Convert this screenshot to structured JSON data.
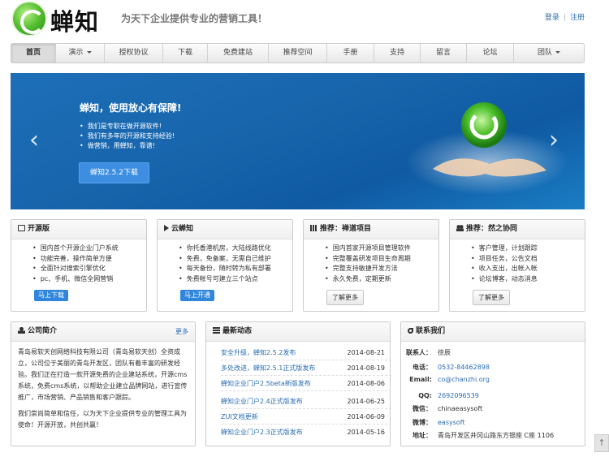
{
  "header": {
    "logo_text": "蝉知",
    "slogan": "为天下企业提供专业的营销工具！",
    "login": "登录",
    "register": "注册"
  },
  "nav": [
    "首页",
    "演示",
    "授权协议",
    "下载",
    "免费建站",
    "推荐空间",
    "手册",
    "支持",
    "留言",
    "论坛",
    "团队"
  ],
  "banner": {
    "title": "蝉知，使用放心有保障!",
    "points": [
      "我们是专职在做开源软件!",
      "我们有多年的开源和支持经验!",
      "做营销，用蝉知，靠谱!"
    ],
    "button": "蝉知2.5.2下载",
    "prev": "‹",
    "next": "›"
  },
  "cards": [
    {
      "title": "开源版",
      "items": [
        "国内首个开源企业门户系统",
        "功能完善，操作简单方便",
        "全面针对搜索引擎优化",
        "pc、手机、微信全网营销"
      ],
      "button": "马上下载"
    },
    {
      "title": "云蝉知",
      "items": [
        "你托香港机房，大陆线路优化",
        "免费，免备案，无需自己维护",
        "每天备份，随时转为私有部署",
        "免费帐号可建立三个站点"
      ],
      "button": "马上开通"
    },
    {
      "title": "推荐：禅道项目",
      "items": [
        "国内首家开源项目管理软件",
        "完整覆盖研发项目生命周期",
        "完整支持敏捷开发方法",
        "永久免费，定期更新"
      ],
      "button": "了解更多"
    },
    {
      "title": "推荐：然之协同",
      "items": [
        "客户管理，计划跟踪",
        "项目任务，公告文档",
        "收入支出，出帐入帐",
        "论坛博客，动态消息"
      ],
      "button": "了解更多"
    }
  ],
  "intro": {
    "title": "公司简介",
    "more": "更多",
    "p1": "青岛易软天创网络科技有限公司（青岛易软天创）全资成立，公司位于美丽的青岛开发区，团队有着丰富的研发经验。我们正在打造一款开源免费的企业建站系统，开源cms系统，免费cms系统，以帮助企业建立品牌网站，进行宣传推广，市场营销、产品销售和客户跟踪。",
    "p2": "我们崇尚简单和信任，以为天下企业提供专业的管理工具为使命！开源开放，共创共赢！"
  },
  "news": {
    "title": "最新动态",
    "items": [
      {
        "t": "安全升级，蝉知2.5.2发布",
        "d": "2014-08-21"
      },
      {
        "t": "多处改进，蝉知2.5.1正式版发布",
        "d": "2014-08-19"
      },
      {
        "t": "蝉知企业门户2.5beta新版发布",
        "d": "2014-08-06"
      },
      {
        "t": "蝉知企业门户2.4正式版发布",
        "d": "2014-06-25"
      },
      {
        "t": "ZUI文档更新",
        "d": "2014-06-09"
      },
      {
        "t": "蝉知企业门户2.3正式版发布",
        "d": "2014-05-16"
      }
    ]
  },
  "contact": {
    "title": "联系我们",
    "rows": [
      {
        "k": "联系人：",
        "v": "徐辰"
      },
      {
        "k": "电话：",
        "v": "0532-84462898"
      },
      {
        "k": "Email:",
        "v": "co@chanzhi.org"
      },
      {
        "k": "QQ:",
        "v": "2692096539"
      },
      {
        "k": "微信：",
        "v": "chinaeasysoft"
      },
      {
        "k": "微博：",
        "v": "easysoft"
      },
      {
        "k": "地址：",
        "v": "青岛开发区井冈山路东方银座 C座 1106"
      }
    ]
  },
  "scroll_top": "↑",
  "colors": {
    "link": "#2a6db3",
    "banner": "#1764ab",
    "button": "#2f86dc"
  }
}
